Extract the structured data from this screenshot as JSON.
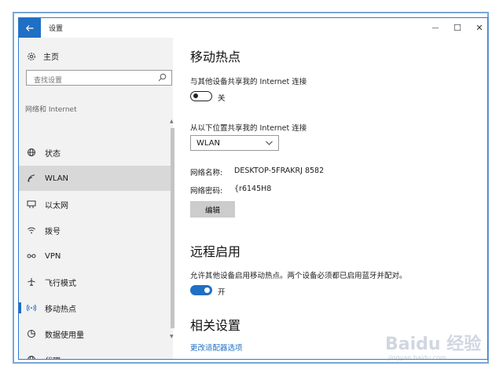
{
  "window": {
    "title": "设置",
    "controls": {
      "minimize": "—",
      "maximize": "☐",
      "close": "✕"
    }
  },
  "sidebar": {
    "home_label": "主页",
    "search": {
      "placeholder": "查找设置"
    },
    "category": "网络和 Internet",
    "items": [
      {
        "label": "状态",
        "icon": "globe-status-icon"
      },
      {
        "label": "WLAN",
        "icon": "wifi-icon"
      },
      {
        "label": "以太网",
        "icon": "ethernet-icon"
      },
      {
        "label": "拨号",
        "icon": "dialup-icon"
      },
      {
        "label": "VPN",
        "icon": "vpn-icon"
      },
      {
        "label": "飞行模式",
        "icon": "airplane-icon"
      },
      {
        "label": "移动热点",
        "icon": "hotspot-icon"
      },
      {
        "label": "数据使用量",
        "icon": "data-usage-icon"
      },
      {
        "label": "代理",
        "icon": "globe-icon"
      }
    ],
    "selected_index": 6,
    "hover_index": 1
  },
  "main": {
    "hotspot": {
      "heading": "移动热点",
      "share_label": "与其他设备共享我的 Internet 连接",
      "share_toggle": {
        "state": "off",
        "label": "关"
      },
      "share_from_label": "从以下位置共享我的 Internet 连接",
      "share_from_value": "WLAN",
      "network_name_key": "网络名称:",
      "network_name_value": "DESKTOP-5FRAKRJ 8582",
      "network_password_key": "网络密码:",
      "network_password_value": "{r6145H8",
      "edit_button": "编辑"
    },
    "remote": {
      "heading": "远程启用",
      "description": "允许其他设备启用移动热点。两个设备必须都已启用蓝牙并配对。",
      "toggle": {
        "state": "on",
        "label": "开"
      }
    },
    "related": {
      "heading": "相关设置",
      "link": "更改适配器选项"
    }
  },
  "watermark": {
    "text": "Baidu 经验",
    "sub": "jingyan.baidu.com"
  },
  "colors": {
    "accent": "#1f6fc5",
    "sidebar_bg": "#f2f2f2",
    "frame": "#7aa6d8"
  }
}
